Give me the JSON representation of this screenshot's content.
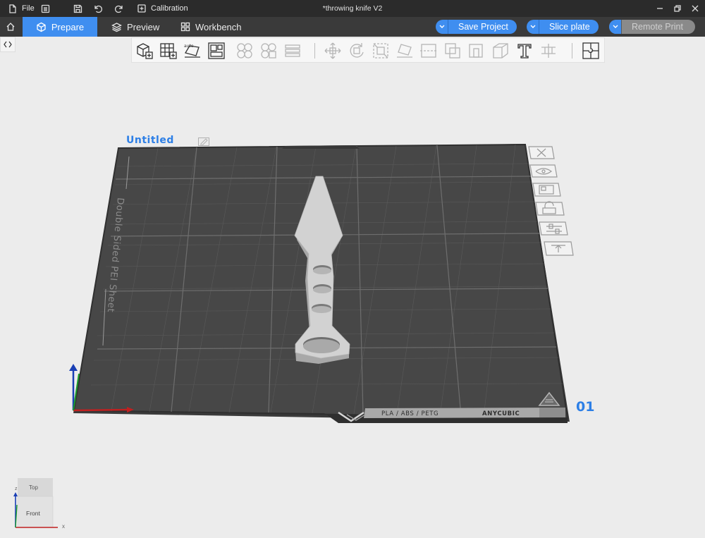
{
  "titlebar": {
    "file_label": "File",
    "calibration_label": "Calibration",
    "window_title": "*throwing knife V2"
  },
  "navbar": {
    "tabs": [
      {
        "label": "Prepare",
        "active": true
      },
      {
        "label": "Preview",
        "active": false
      },
      {
        "label": "Workbench",
        "active": false
      }
    ],
    "save_project": "Save Project",
    "slice_plate": "Slice plate",
    "remote_print": "Remote Print",
    "remote_print_enabled": false
  },
  "plate": {
    "name": "Untitled",
    "number": "01",
    "sheet_label": "Double Sided PEI Sheet",
    "material_label": "PLA / ABS / PETG",
    "brand_label": "ANYCUBIC"
  },
  "nav_cube": {
    "top_label": "Top",
    "front_label": "Front",
    "x_axis": "x",
    "z_axis": "z"
  },
  "colors": {
    "accent": "#3f8ef0",
    "titlebar_bg": "#2b2b2b",
    "navbar_bg": "#3a3a3a",
    "plate_bg": "#474747",
    "model": "#d2d2d2",
    "plate_label": "#2d7fe6"
  }
}
